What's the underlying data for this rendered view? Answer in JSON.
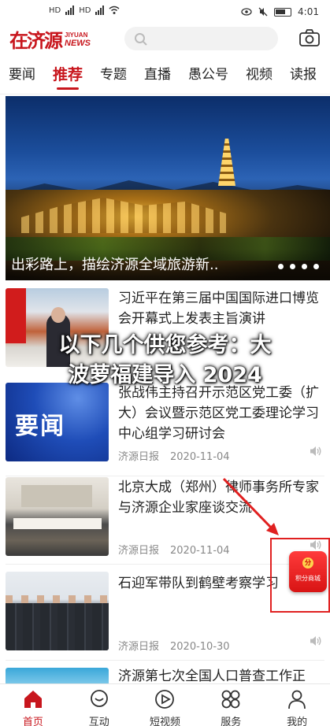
{
  "status_bar": {
    "left": [
      "HD",
      "4G",
      "HD",
      "4G"
    ],
    "time": "4:01"
  },
  "header": {
    "logo_cn": "济源",
    "logo_en_top": "JIYUAN",
    "logo_en_bottom": "NEWS",
    "search_placeholder": ""
  },
  "tabs": [
    {
      "label": "要闻",
      "active": false
    },
    {
      "label": "推荐",
      "active": true
    },
    {
      "label": "专题",
      "active": false
    },
    {
      "label": "直播",
      "active": false
    },
    {
      "label": "愚公号",
      "active": false
    },
    {
      "label": "视频",
      "active": false
    },
    {
      "label": "读报",
      "active": false
    }
  ],
  "banner": {
    "caption": "出彩路上，描绘济源全域旅游新..",
    "slides": 4
  },
  "news": [
    {
      "title": "习近平在第三届中国国际进口博览会开幕式上发表主旨演讲",
      "source": "",
      "date": ""
    },
    {
      "title": "张战伟主持召开示范区党工委（扩大）会议暨示范区党工委理论学习中心组学习研讨会",
      "source": "济源日报",
      "date": "2020-11-04",
      "thumb_text": "要闻"
    },
    {
      "title": "北京大成（郑州）律师事务所专家与济源企业家座谈交流",
      "source": "济源日报",
      "date": "2020-11-04"
    },
    {
      "title": "石迎军带队到鹤壁考察学习",
      "source": "济源日报",
      "date": "2020-10-30"
    },
    {
      "title": "济源第七次全国人口普查工作正",
      "source": "",
      "date": ""
    }
  ],
  "overlay": {
    "line1": "以下几个供您参考：大",
    "line2": "波萝福建导入 2024"
  },
  "floating": {
    "badge": "分",
    "label": "积分商城"
  },
  "bottom_nav": [
    {
      "label": "首页",
      "icon": "home-icon",
      "active": true
    },
    {
      "label": "互动",
      "icon": "chat-icon",
      "active": false
    },
    {
      "label": "短视频",
      "icon": "play-icon",
      "active": false
    },
    {
      "label": "服务",
      "icon": "services-icon",
      "active": false
    },
    {
      "label": "我的",
      "icon": "profile-icon",
      "active": false
    }
  ],
  "colors": {
    "brand": "#c8161d",
    "annotation": "#e02020"
  }
}
